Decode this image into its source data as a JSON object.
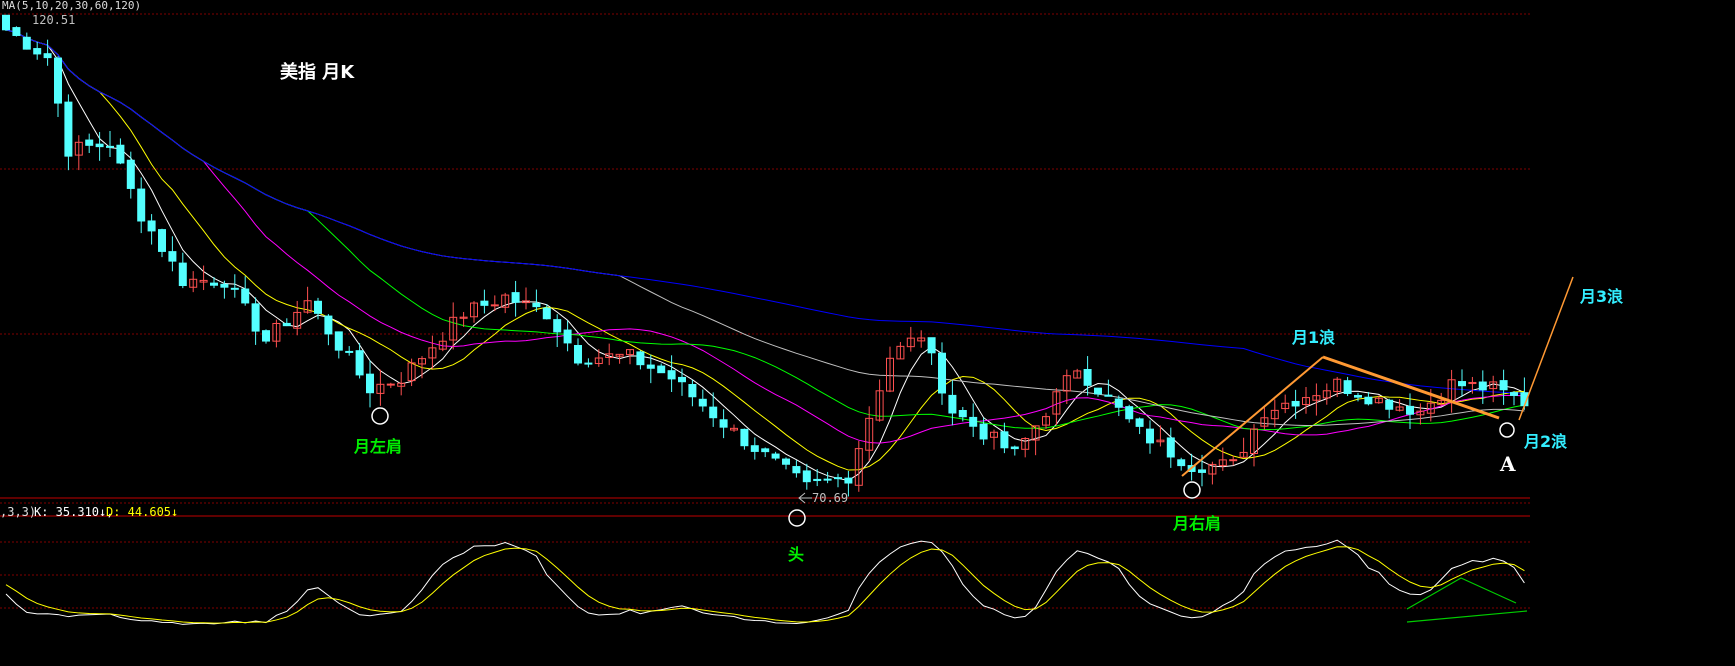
{
  "chart_data": {
    "type": "candlestick",
    "title": "美指 月K",
    "ma_legend": "MA(5,10,20,30,60,120)",
    "ma_periods": [
      5,
      10,
      20,
      30,
      60,
      120
    ],
    "ma_colors": [
      "#ffffff",
      "#ffff00",
      "#ff00ff",
      "#00ff00",
      "#c0c0c0",
      "#0000ff"
    ],
    "up_color": "#ff5050",
    "down_color": "#54ffff",
    "ylim": [
      70.69,
      120.51
    ],
    "high_label": "120.51",
    "low_label": "70.69",
    "candle_count": 147,
    "close_keypoints": [
      [
        0,
        119.1
      ],
      [
        4,
        116.3
      ],
      [
        6,
        106.7
      ],
      [
        10,
        107.3
      ],
      [
        13,
        100.0
      ],
      [
        17,
        93.2
      ],
      [
        21,
        93.2
      ],
      [
        25,
        87.0
      ],
      [
        29,
        91.0
      ],
      [
        35,
        82.0
      ],
      [
        38,
        83.1
      ],
      [
        44,
        89.8
      ],
      [
        48,
        91.5
      ],
      [
        52,
        89.8
      ],
      [
        55,
        85.3
      ],
      [
        60,
        85.3
      ],
      [
        64,
        83.1
      ],
      [
        70,
        77.5
      ],
      [
        77,
        71.8
      ],
      [
        81,
        73.0
      ],
      [
        85,
        85.3
      ],
      [
        88,
        87.6
      ],
      [
        91,
        79.7
      ],
      [
        97,
        75.2
      ],
      [
        100,
        79.7
      ],
      [
        103,
        84.2
      ],
      [
        105,
        82.0
      ],
      [
        109,
        77.5
      ],
      [
        114,
        74.1
      ],
      [
        118,
        74.1
      ],
      [
        121,
        79.7
      ],
      [
        128,
        82.5
      ],
      [
        132,
        80.8
      ],
      [
        136,
        79.7
      ],
      [
        139,
        82.5
      ],
      [
        143,
        82.0
      ],
      [
        146,
        80.6
      ]
    ],
    "kdj": {
      "params_label": ",3,3)",
      "K_label": "K: 35.310↓,",
      "D_label": "D: 44.605↓",
      "K_color": "#ffffff",
      "D_color": "#ffff00"
    }
  },
  "annotations": {
    "title": "美指 月K",
    "left_shoulder": "月左肩",
    "head": "头",
    "right_shoulder": "月右肩",
    "wave1": "月1浪",
    "wave2": "月2浪",
    "wave3": "月3浪",
    "point_a": "A"
  }
}
